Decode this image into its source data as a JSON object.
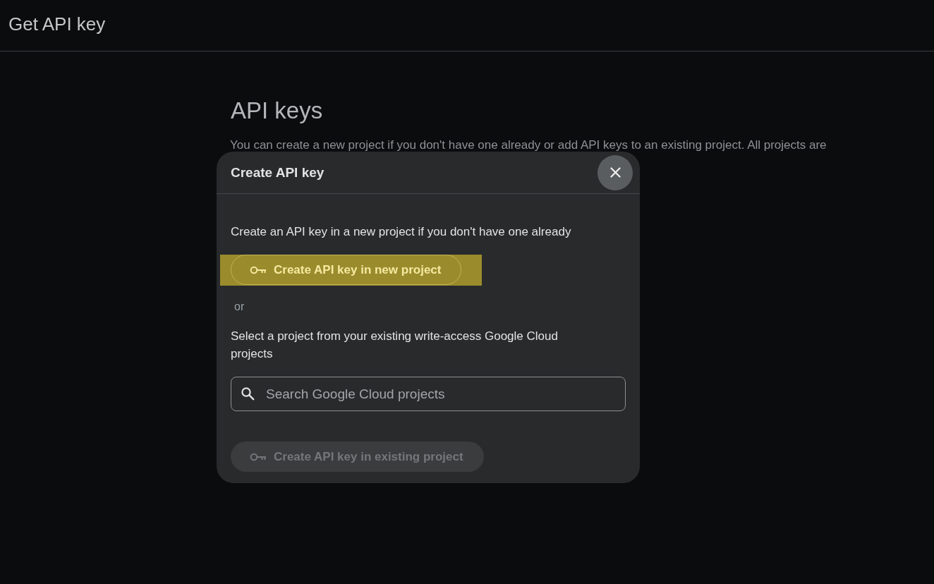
{
  "header": {
    "title": "Get API key"
  },
  "page": {
    "heading": "API keys",
    "description": "You can create a new project if you don't have one already or add API keys to an existing project. All projects are"
  },
  "dialog": {
    "title": "Create API key",
    "new_project_hint": "Create an API key in a new project if you don't have one already",
    "new_project_button": {
      "label": "Create API key in new project",
      "disabled": false,
      "highlighted": true
    },
    "separator": "or",
    "existing_project_hint": "Select a project from your existing write-access Google Cloud projects",
    "search": {
      "placeholder": "Search Google Cloud projects"
    },
    "existing_project_button": {
      "label": "Create API key in existing project",
      "disabled": true
    }
  }
}
